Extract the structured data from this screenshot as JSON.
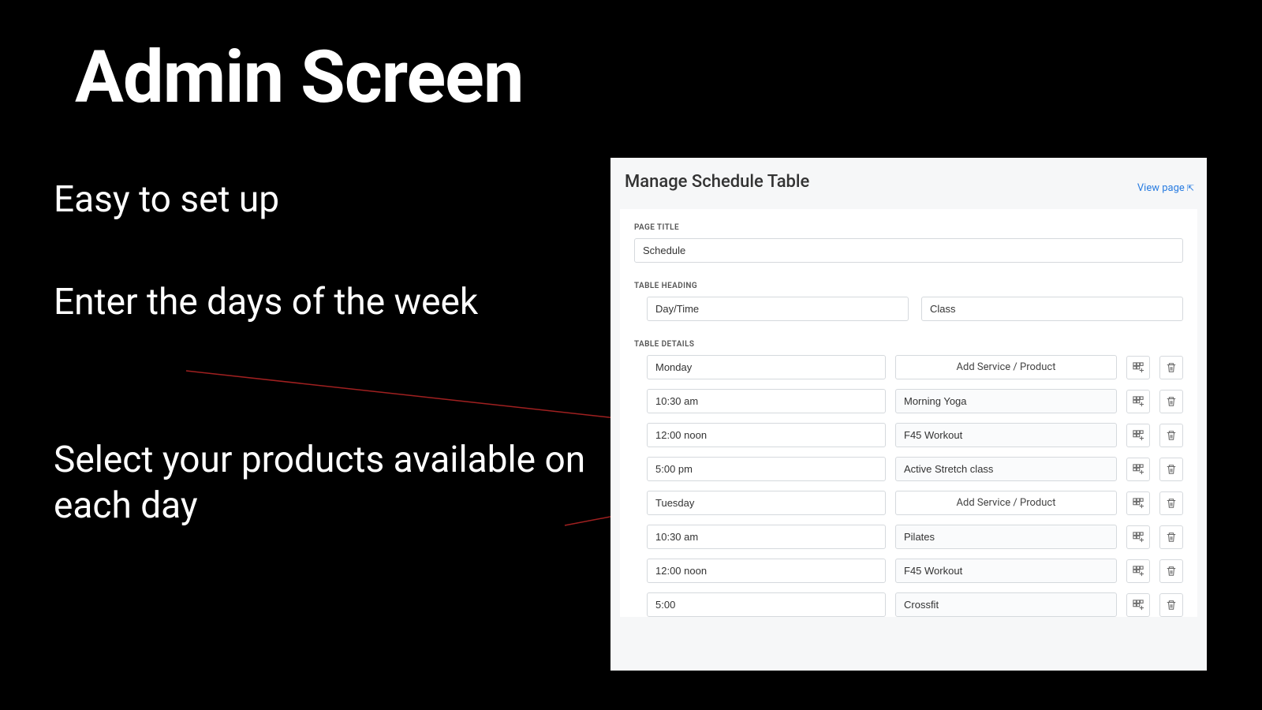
{
  "slide": {
    "title": "Admin Screen",
    "bullet1": "Easy to set up",
    "bullet2": "Enter the days of the week",
    "bullet3": "Select your products available on each day"
  },
  "panel": {
    "title": "Manage Schedule Table",
    "view_page": "View page",
    "labels": {
      "page_title": "PAGE TITLE",
      "table_heading": "TABLE HEADING",
      "table_details": "TABLE DETAILS"
    },
    "page_title_value": "Schedule",
    "heading_col1": "Day/Time",
    "heading_col2": "Class",
    "add_label": "Add Service / Product",
    "rows": [
      {
        "left": "Monday",
        "right": "",
        "isDay": true
      },
      {
        "left": "10:30 am",
        "right": "Morning Yoga",
        "isDay": false
      },
      {
        "left": "12:00 noon",
        "right": "F45 Workout",
        "isDay": false
      },
      {
        "left": "5:00 pm",
        "right": "Active Stretch class",
        "isDay": false
      },
      {
        "left": "Tuesday",
        "right": "",
        "isDay": true
      },
      {
        "left": "10:30 am",
        "right": "Pilates",
        "isDay": false
      },
      {
        "left": "12:00 noon",
        "right": "F45 Workout",
        "isDay": false
      },
      {
        "left": "5:00",
        "right": "Crossfit",
        "isDay": false
      }
    ]
  }
}
